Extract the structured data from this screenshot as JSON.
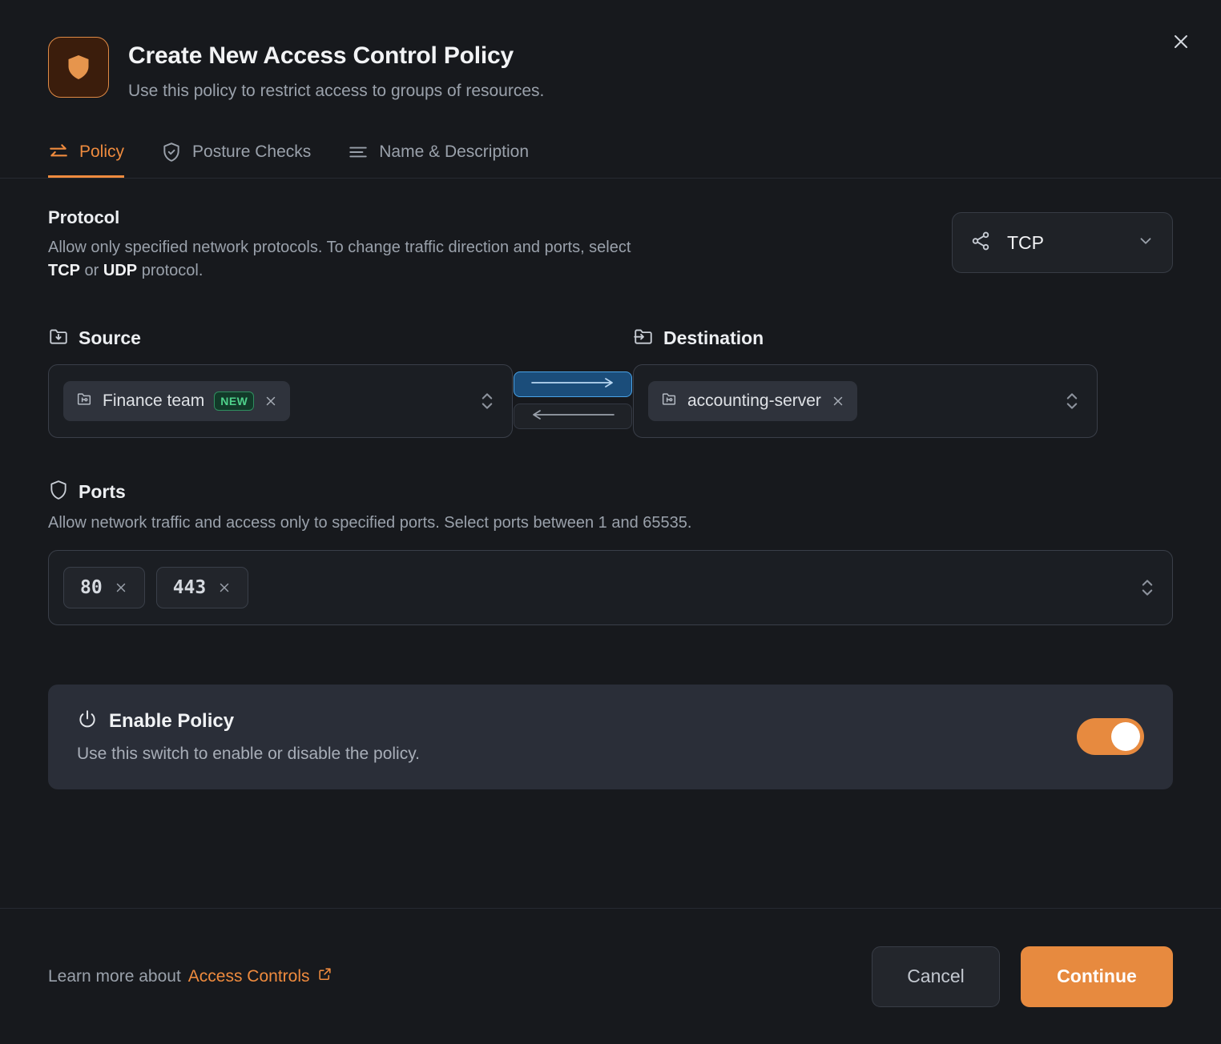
{
  "header": {
    "icon": "shield-icon",
    "title": "Create New Access Control Policy",
    "subtitle": "Use this policy to restrict access to groups of resources.",
    "close_label": "×"
  },
  "tabs": [
    {
      "label": "Policy",
      "icon": "transfer-arrows-icon",
      "active": true
    },
    {
      "label": "Posture Checks",
      "icon": "shield-check-icon",
      "active": false
    },
    {
      "label": "Name & Description",
      "icon": "list-lines-icon",
      "active": false
    }
  ],
  "protocol": {
    "title": "Protocol",
    "desc_part1": "Allow only specified network protocols. To change traffic direction and ports, select ",
    "desc_tcp": "TCP",
    "desc_or": " or ",
    "desc_udp": "UDP",
    "desc_part2": " protocol.",
    "selected": "TCP",
    "icon": "share-network-icon",
    "chevron": "chevron-down-icon"
  },
  "source": {
    "label": "Source",
    "icon": "folder-down-icon",
    "chips": [
      {
        "label": "Finance team",
        "icon": "folder-group-icon",
        "badge": "NEW",
        "remove": "×"
      }
    ]
  },
  "destination": {
    "label": "Destination",
    "icon": "folder-in-icon",
    "chips": [
      {
        "label": "accounting-server",
        "icon": "folder-group-icon",
        "badge": "",
        "remove": "×"
      }
    ]
  },
  "direction": {
    "forward": "arrow-right-icon",
    "backward": "arrow-left-icon",
    "forward_selected": true
  },
  "ports": {
    "title": "Ports",
    "icon": "shield-outline-icon",
    "desc": "Allow network traffic and access only to specified ports. Select ports between 1 and 65535.",
    "values": [
      "80",
      "443"
    ]
  },
  "enable_policy": {
    "title": "Enable Policy",
    "icon": "power-icon",
    "desc": "Use this switch to enable or disable the policy.",
    "enabled": true
  },
  "footer": {
    "learn_prefix": "Learn more about",
    "learn_link": "Access Controls",
    "link_icon": "external-link-icon",
    "cancel_label": "Cancel",
    "continue_label": "Continue"
  },
  "colors": {
    "accent": "#ef8b3e",
    "background": "#17191d",
    "card": "#2a2e38",
    "badge_green": "#4fd18b",
    "direction_blue": "#4aa3e8"
  }
}
